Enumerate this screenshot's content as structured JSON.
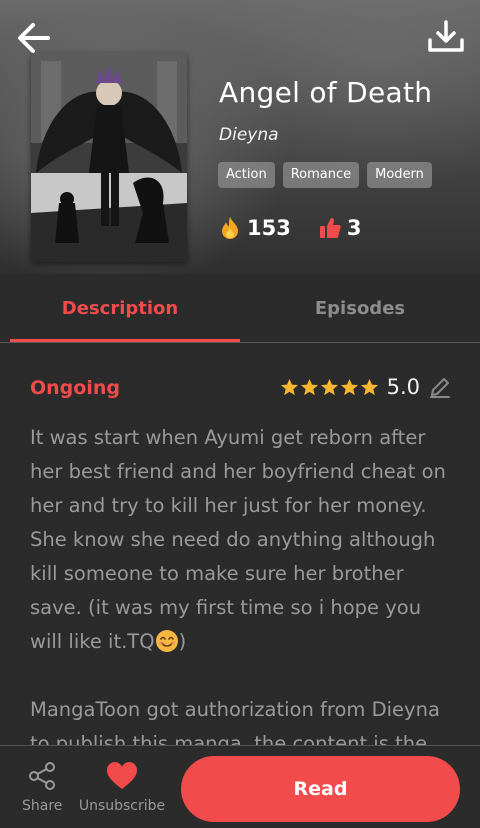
{
  "header": {
    "back_icon": "arrow-left-icon",
    "download_icon": "download-icon",
    "title": "Angel of Death",
    "author": "Dieyna",
    "tags": [
      "Action",
      "Romance",
      "Modern"
    ],
    "views_icon": "flame-icon",
    "views": "153",
    "likes_icon": "thumbs-up-icon",
    "likes": "3",
    "accent_color": "#f24b4b"
  },
  "tabs": [
    {
      "label": "Description",
      "active": true
    },
    {
      "label": "Episodes",
      "active": false
    }
  ],
  "content": {
    "status": "Ongoing",
    "rating": 5,
    "score": "5.0",
    "description_1": "It was start when Ayumi get reborn after her best friend and her boyfriend cheat on her and try to kill her just for her money. She know she need do anything although kill someone to make sure her brother save. (it was my first time so i hope you will like it.TQ",
    "description_1_end": ")",
    "description_2": "MangaToon got authorization from Dieyna to publish this manga, the content is the"
  },
  "bottom_bar": {
    "share_label": "Share",
    "unsubscribe_label": "Unsubscribe",
    "read_label": "Read"
  }
}
